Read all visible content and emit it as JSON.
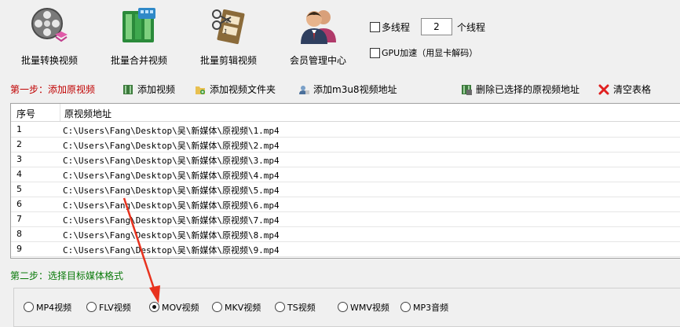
{
  "toolbar": {
    "tools": [
      {
        "label": "批量转换视频"
      },
      {
        "label": "批量合并视频"
      },
      {
        "label": "批量剪辑视频"
      },
      {
        "label": "会员管理中心"
      }
    ],
    "multithread": {
      "label": "多线程",
      "checked": false,
      "count": "2",
      "unit": "个线程"
    },
    "gpu": {
      "label": "GPU加速（用显卡解码）",
      "checked": false
    }
  },
  "step1": {
    "label": "第一步：添加原视频",
    "buttons": {
      "add_video": "添加视频",
      "add_folder": "添加视频文件夹",
      "add_m3u8": "添加m3u8视频地址",
      "delete_selected": "删除已选择的原视频地址",
      "clear_table": "清空表格"
    }
  },
  "table": {
    "headers": {
      "index": "序号",
      "path": "原视频地址"
    },
    "rows": [
      {
        "index": "1",
        "path": "C:\\Users\\Fang\\Desktop\\吴\\新媒体\\原视频\\1.mp4"
      },
      {
        "index": "2",
        "path": "C:\\Users\\Fang\\Desktop\\吴\\新媒体\\原视频\\2.mp4"
      },
      {
        "index": "3",
        "path": "C:\\Users\\Fang\\Desktop\\吴\\新媒体\\原视频\\3.mp4"
      },
      {
        "index": "4",
        "path": "C:\\Users\\Fang\\Desktop\\吴\\新媒体\\原视频\\4.mp4"
      },
      {
        "index": "5",
        "path": "C:\\Users\\Fang\\Desktop\\吴\\新媒体\\原视频\\5.mp4"
      },
      {
        "index": "6",
        "path": "C:\\Users\\Fang\\Desktop\\吴\\新媒体\\原视频\\6.mp4"
      },
      {
        "index": "7",
        "path": "C:\\Users\\Fang\\Desktop\\吴\\新媒体\\原视频\\7.mp4"
      },
      {
        "index": "8",
        "path": "C:\\Users\\Fang\\Desktop\\吴\\新媒体\\原视频\\8.mp4"
      },
      {
        "index": "9",
        "path": "C:\\Users\\Fang\\Desktop\\吴\\新媒体\\原视频\\9.mp4"
      }
    ]
  },
  "step2": {
    "label": "第二步：选择目标媒体格式",
    "formats": [
      "MP4视频",
      "FLV视频",
      "MOV视频",
      "MKV视频",
      "TS视频",
      "WMV视频",
      "MP3音频"
    ],
    "selected": "MOV视频"
  },
  "colors": {
    "step1": "#c00000",
    "step2": "#0a7a0a",
    "arrow": "#e8321e"
  }
}
